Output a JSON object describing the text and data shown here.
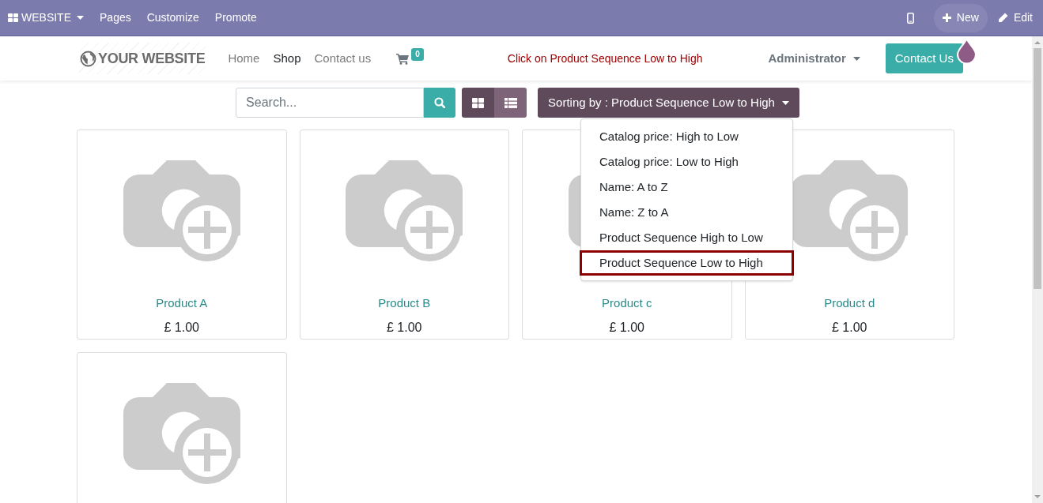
{
  "topbar": {
    "app_menu": "WEBSITE",
    "menu": [
      "Pages",
      "Customize",
      "Promote"
    ],
    "new": "New",
    "edit": "Edit"
  },
  "header": {
    "logo": "YOUR WEBSITE",
    "nav": [
      {
        "label": "Home",
        "selected": false
      },
      {
        "label": "Shop",
        "selected": true
      },
      {
        "label": "Contact us",
        "selected": false
      }
    ],
    "cart_count": "0",
    "annotation": "Click on Product Sequence Low to High",
    "user": "Administrator",
    "cta": "Contact Us"
  },
  "toolbar": {
    "search_placeholder": "Search...",
    "views": [
      {
        "kind": "grid",
        "selected": true
      },
      {
        "kind": "list",
        "selected": false
      }
    ],
    "sort_label": "Sorting by : Product Sequence Low to High"
  },
  "sort_menu": [
    {
      "label": "Catalog price: High to Low",
      "highlighted": false
    },
    {
      "label": "Catalog price: Low to High",
      "highlighted": false
    },
    {
      "label": "Name: A to Z",
      "highlighted": false
    },
    {
      "label": "Name: Z to A",
      "highlighted": false
    },
    {
      "label": "Product Sequence High to Low",
      "highlighted": false
    },
    {
      "label": "Product Sequence Low to High",
      "highlighted": true
    }
  ],
  "products": [
    {
      "kind": "product",
      "name": "Product A",
      "price": "£ 1.00"
    },
    {
      "kind": "product",
      "name": "Product B",
      "price": "£ 1.00"
    },
    {
      "kind": "product",
      "name": "Product c",
      "price": "£ 1.00"
    },
    {
      "kind": "product",
      "name": "Product d",
      "price": "£ 1.00"
    },
    {
      "kind": "product"
    }
  ]
}
